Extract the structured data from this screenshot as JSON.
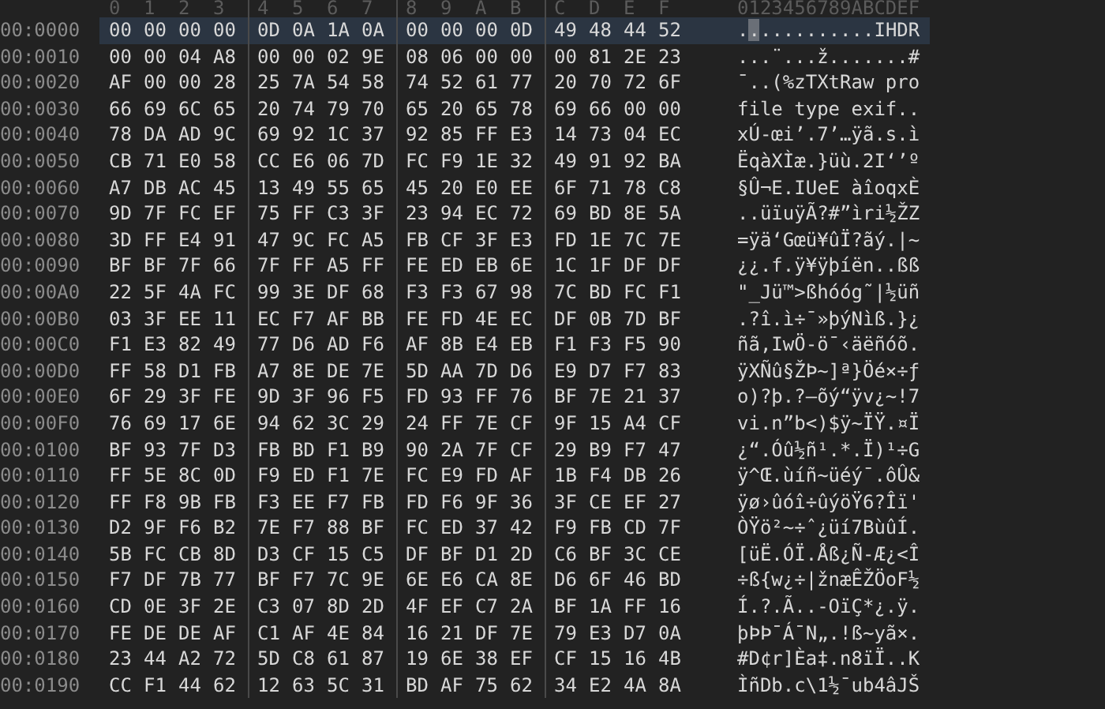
{
  "header": {
    "columns": [
      "0",
      "1",
      "2",
      "3",
      "4",
      "5",
      "6",
      "7",
      "8",
      "9",
      "A",
      "B",
      "C",
      "D",
      "E",
      "F"
    ],
    "ascii": "0123456789ABCDEF"
  },
  "rows": [
    {
      "offset": "00:0000",
      "selected": true,
      "bytes": [
        "00",
        "00",
        "00",
        "00",
        "0D",
        "0A",
        "1A",
        "0A",
        "00",
        "00",
        "00",
        "0D",
        "49",
        "48",
        "44",
        "52"
      ],
      "ascii": [
        {
          "text": ".",
          "cursor": false
        },
        {
          "text": ".",
          "cursor": true
        },
        {
          "text": "..........IHDR",
          "cursor": false
        }
      ]
    },
    {
      "offset": "00:0010",
      "selected": false,
      "bytes": [
        "00",
        "00",
        "04",
        "A8",
        "00",
        "00",
        "02",
        "9E",
        "08",
        "06",
        "00",
        "00",
        "00",
        "81",
        "2E",
        "23"
      ],
      "ascii": [
        {
          "text": "...¨...ž.......#",
          "cursor": false
        }
      ]
    },
    {
      "offset": "00:0020",
      "selected": false,
      "bytes": [
        "AF",
        "00",
        "00",
        "28",
        "25",
        "7A",
        "54",
        "58",
        "74",
        "52",
        "61",
        "77",
        "20",
        "70",
        "72",
        "6F"
      ],
      "ascii": [
        {
          "text": "¯..(%zTXtRaw pro",
          "cursor": false
        }
      ]
    },
    {
      "offset": "00:0030",
      "selected": false,
      "bytes": [
        "66",
        "69",
        "6C",
        "65",
        "20",
        "74",
        "79",
        "70",
        "65",
        "20",
        "65",
        "78",
        "69",
        "66",
        "00",
        "00"
      ],
      "ascii": [
        {
          "text": "file type exif..",
          "cursor": false
        }
      ]
    },
    {
      "offset": "00:0040",
      "selected": false,
      "bytes": [
        "78",
        "DA",
        "AD",
        "9C",
        "69",
        "92",
        "1C",
        "37",
        "92",
        "85",
        "FF",
        "E3",
        "14",
        "73",
        "04",
        "EC"
      ],
      "ascii": [
        {
          "text": "xÚ-œi’.7’…ÿã.s.ì",
          "cursor": false
        }
      ]
    },
    {
      "offset": "00:0050",
      "selected": false,
      "bytes": [
        "CB",
        "71",
        "E0",
        "58",
        "CC",
        "E6",
        "06",
        "7D",
        "FC",
        "F9",
        "1E",
        "32",
        "49",
        "91",
        "92",
        "BA"
      ],
      "ascii": [
        {
          "text": "ËqàXÌæ.}üù.2I‘’º",
          "cursor": false
        }
      ]
    },
    {
      "offset": "00:0060",
      "selected": false,
      "bytes": [
        "A7",
        "DB",
        "AC",
        "45",
        "13",
        "49",
        "55",
        "65",
        "45",
        "20",
        "E0",
        "EE",
        "6F",
        "71",
        "78",
        "C8"
      ],
      "ascii": [
        {
          "text": "§Û¬E.IUeE àîoqxÈ",
          "cursor": false
        }
      ]
    },
    {
      "offset": "00:0070",
      "selected": false,
      "bytes": [
        "9D",
        "7F",
        "FC",
        "EF",
        "75",
        "FF",
        "C3",
        "3F",
        "23",
        "94",
        "EC",
        "72",
        "69",
        "BD",
        "8E",
        "5A"
      ],
      "ascii": [
        {
          "text": "..üïuÿÃ?#”ìri½ŽZ",
          "cursor": false
        }
      ]
    },
    {
      "offset": "00:0080",
      "selected": false,
      "bytes": [
        "3D",
        "FF",
        "E4",
        "91",
        "47",
        "9C",
        "FC",
        "A5",
        "FB",
        "CF",
        "3F",
        "E3",
        "FD",
        "1E",
        "7C",
        "7E"
      ],
      "ascii": [
        {
          "text": "=ÿä‘Gœü¥ûÏ?ãý.|~",
          "cursor": false
        }
      ]
    },
    {
      "offset": "00:0090",
      "selected": false,
      "bytes": [
        "BF",
        "BF",
        "7F",
        "66",
        "7F",
        "FF",
        "A5",
        "FF",
        "FE",
        "ED",
        "EB",
        "6E",
        "1C",
        "1F",
        "DF",
        "DF"
      ],
      "ascii": [
        {
          "text": "¿¿.f.ÿ¥ÿþíën..ßß",
          "cursor": false
        }
      ]
    },
    {
      "offset": "00:00A0",
      "selected": false,
      "bytes": [
        "22",
        "5F",
        "4A",
        "FC",
        "99",
        "3E",
        "DF",
        "68",
        "F3",
        "F3",
        "67",
        "98",
        "7C",
        "BD",
        "FC",
        "F1"
      ],
      "ascii": [
        {
          "text": "\"_Jü™>ßhóóg˜|½üñ",
          "cursor": false
        }
      ]
    },
    {
      "offset": "00:00B0",
      "selected": false,
      "bytes": [
        "03",
        "3F",
        "EE",
        "11",
        "EC",
        "F7",
        "AF",
        "BB",
        "FE",
        "FD",
        "4E",
        "EC",
        "DF",
        "0B",
        "7D",
        "BF"
      ],
      "ascii": [
        {
          "text": ".?î.ì÷¯»þýNìß.}¿",
          "cursor": false
        }
      ]
    },
    {
      "offset": "00:00C0",
      "selected": false,
      "bytes": [
        "F1",
        "E3",
        "82",
        "49",
        "77",
        "D6",
        "AD",
        "F6",
        "AF",
        "8B",
        "E4",
        "EB",
        "F1",
        "F3",
        "F5",
        "90"
      ],
      "ascii": [
        {
          "text": "ñã‚IwÖ-ö¯‹äëñóõ.",
          "cursor": false
        }
      ]
    },
    {
      "offset": "00:00D0",
      "selected": false,
      "bytes": [
        "FF",
        "58",
        "D1",
        "FB",
        "A7",
        "8E",
        "DE",
        "7E",
        "5D",
        "AA",
        "7D",
        "D6",
        "E9",
        "D7",
        "F7",
        "83"
      ],
      "ascii": [
        {
          "text": "ÿXÑû§ŽÞ~]ª}Öé×÷ƒ",
          "cursor": false
        }
      ]
    },
    {
      "offset": "00:00E0",
      "selected": false,
      "bytes": [
        "6F",
        "29",
        "3F",
        "FE",
        "9D",
        "3F",
        "96",
        "F5",
        "FD",
        "93",
        "FF",
        "76",
        "BF",
        "7E",
        "21",
        "37"
      ],
      "ascii": [
        {
          "text": "o)?þ.?–õý“ÿv¿~!7",
          "cursor": false
        }
      ]
    },
    {
      "offset": "00:00F0",
      "selected": false,
      "bytes": [
        "76",
        "69",
        "17",
        "6E",
        "94",
        "62",
        "3C",
        "29",
        "24",
        "FF",
        "7E",
        "CF",
        "9F",
        "15",
        "A4",
        "CF"
      ],
      "ascii": [
        {
          "text": "vi.n”b<)$ÿ~ÏŸ.¤Ï",
          "cursor": false
        }
      ]
    },
    {
      "offset": "00:0100",
      "selected": false,
      "bytes": [
        "BF",
        "93",
        "7F",
        "D3",
        "FB",
        "BD",
        "F1",
        "B9",
        "90",
        "2A",
        "7F",
        "CF",
        "29",
        "B9",
        "F7",
        "47"
      ],
      "ascii": [
        {
          "text": "¿“.Óû½ñ¹.*.Ï)¹÷G",
          "cursor": false
        }
      ]
    },
    {
      "offset": "00:0110",
      "selected": false,
      "bytes": [
        "FF",
        "5E",
        "8C",
        "0D",
        "F9",
        "ED",
        "F1",
        "7E",
        "FC",
        "E9",
        "FD",
        "AF",
        "1B",
        "F4",
        "DB",
        "26"
      ],
      "ascii": [
        {
          "text": "ÿ^Œ.ùíñ~üéý¯.ôÛ&",
          "cursor": false
        }
      ]
    },
    {
      "offset": "00:0120",
      "selected": false,
      "bytes": [
        "FF",
        "F8",
        "9B",
        "FB",
        "F3",
        "EE",
        "F7",
        "FB",
        "FD",
        "F6",
        "9F",
        "36",
        "3F",
        "CE",
        "EF",
        "27"
      ],
      "ascii": [
        {
          "text": "ÿø›ûóî÷ûýöŸ6?Îï'",
          "cursor": false
        }
      ]
    },
    {
      "offset": "00:0130",
      "selected": false,
      "bytes": [
        "D2",
        "9F",
        "F6",
        "B2",
        "7E",
        "F7",
        "88",
        "BF",
        "FC",
        "ED",
        "37",
        "42",
        "F9",
        "FB",
        "CD",
        "7F"
      ],
      "ascii": [
        {
          "text": "ÒŸö²~÷ˆ¿üí7BùûÍ.",
          "cursor": false
        }
      ]
    },
    {
      "offset": "00:0140",
      "selected": false,
      "bytes": [
        "5B",
        "FC",
        "CB",
        "8D",
        "D3",
        "CF",
        "15",
        "C5",
        "DF",
        "BF",
        "D1",
        "2D",
        "C6",
        "BF",
        "3C",
        "CE"
      ],
      "ascii": [
        {
          "text": "[üË.ÓÏ.Åß¿Ñ-Æ¿<Î",
          "cursor": false
        }
      ]
    },
    {
      "offset": "00:0150",
      "selected": false,
      "bytes": [
        "F7",
        "DF",
        "7B",
        "77",
        "BF",
        "F7",
        "7C",
        "9E",
        "6E",
        "E6",
        "CA",
        "8E",
        "D6",
        "6F",
        "46",
        "BD"
      ],
      "ascii": [
        {
          "text": "÷ß{w¿÷|žnæÊŽÖoF½",
          "cursor": false
        }
      ]
    },
    {
      "offset": "00:0160",
      "selected": false,
      "bytes": [
        "CD",
        "0E",
        "3F",
        "2E",
        "C3",
        "07",
        "8D",
        "2D",
        "4F",
        "EF",
        "C7",
        "2A",
        "BF",
        "1A",
        "FF",
        "16"
      ],
      "ascii": [
        {
          "text": "Í.?.Ã..-OïÇ*¿.ÿ.",
          "cursor": false
        }
      ]
    },
    {
      "offset": "00:0170",
      "selected": false,
      "bytes": [
        "FE",
        "DE",
        "DE",
        "AF",
        "C1",
        "AF",
        "4E",
        "84",
        "16",
        "21",
        "DF",
        "7E",
        "79",
        "E3",
        "D7",
        "0A"
      ],
      "ascii": [
        {
          "text": "þÞÞ¯Á¯N„.!ß~yã×.",
          "cursor": false
        }
      ]
    },
    {
      "offset": "00:0180",
      "selected": false,
      "bytes": [
        "23",
        "44",
        "A2",
        "72",
        "5D",
        "C8",
        "61",
        "87",
        "19",
        "6E",
        "38",
        "EF",
        "CF",
        "15",
        "16",
        "4B"
      ],
      "ascii": [
        {
          "text": "#D¢r]Èa‡.n8ïÏ..K",
          "cursor": false
        }
      ]
    },
    {
      "offset": "00:0190",
      "selected": false,
      "bytes": [
        "CC",
        "F1",
        "44",
        "62",
        "12",
        "63",
        "5C",
        "31",
        "BD",
        "AF",
        "75",
        "62",
        "34",
        "E2",
        "4A",
        "8A"
      ],
      "ascii": [
        {
          "text": "ÌñDb.c\\1½¯ub4âJŠ",
          "cursor": false
        }
      ]
    }
  ]
}
